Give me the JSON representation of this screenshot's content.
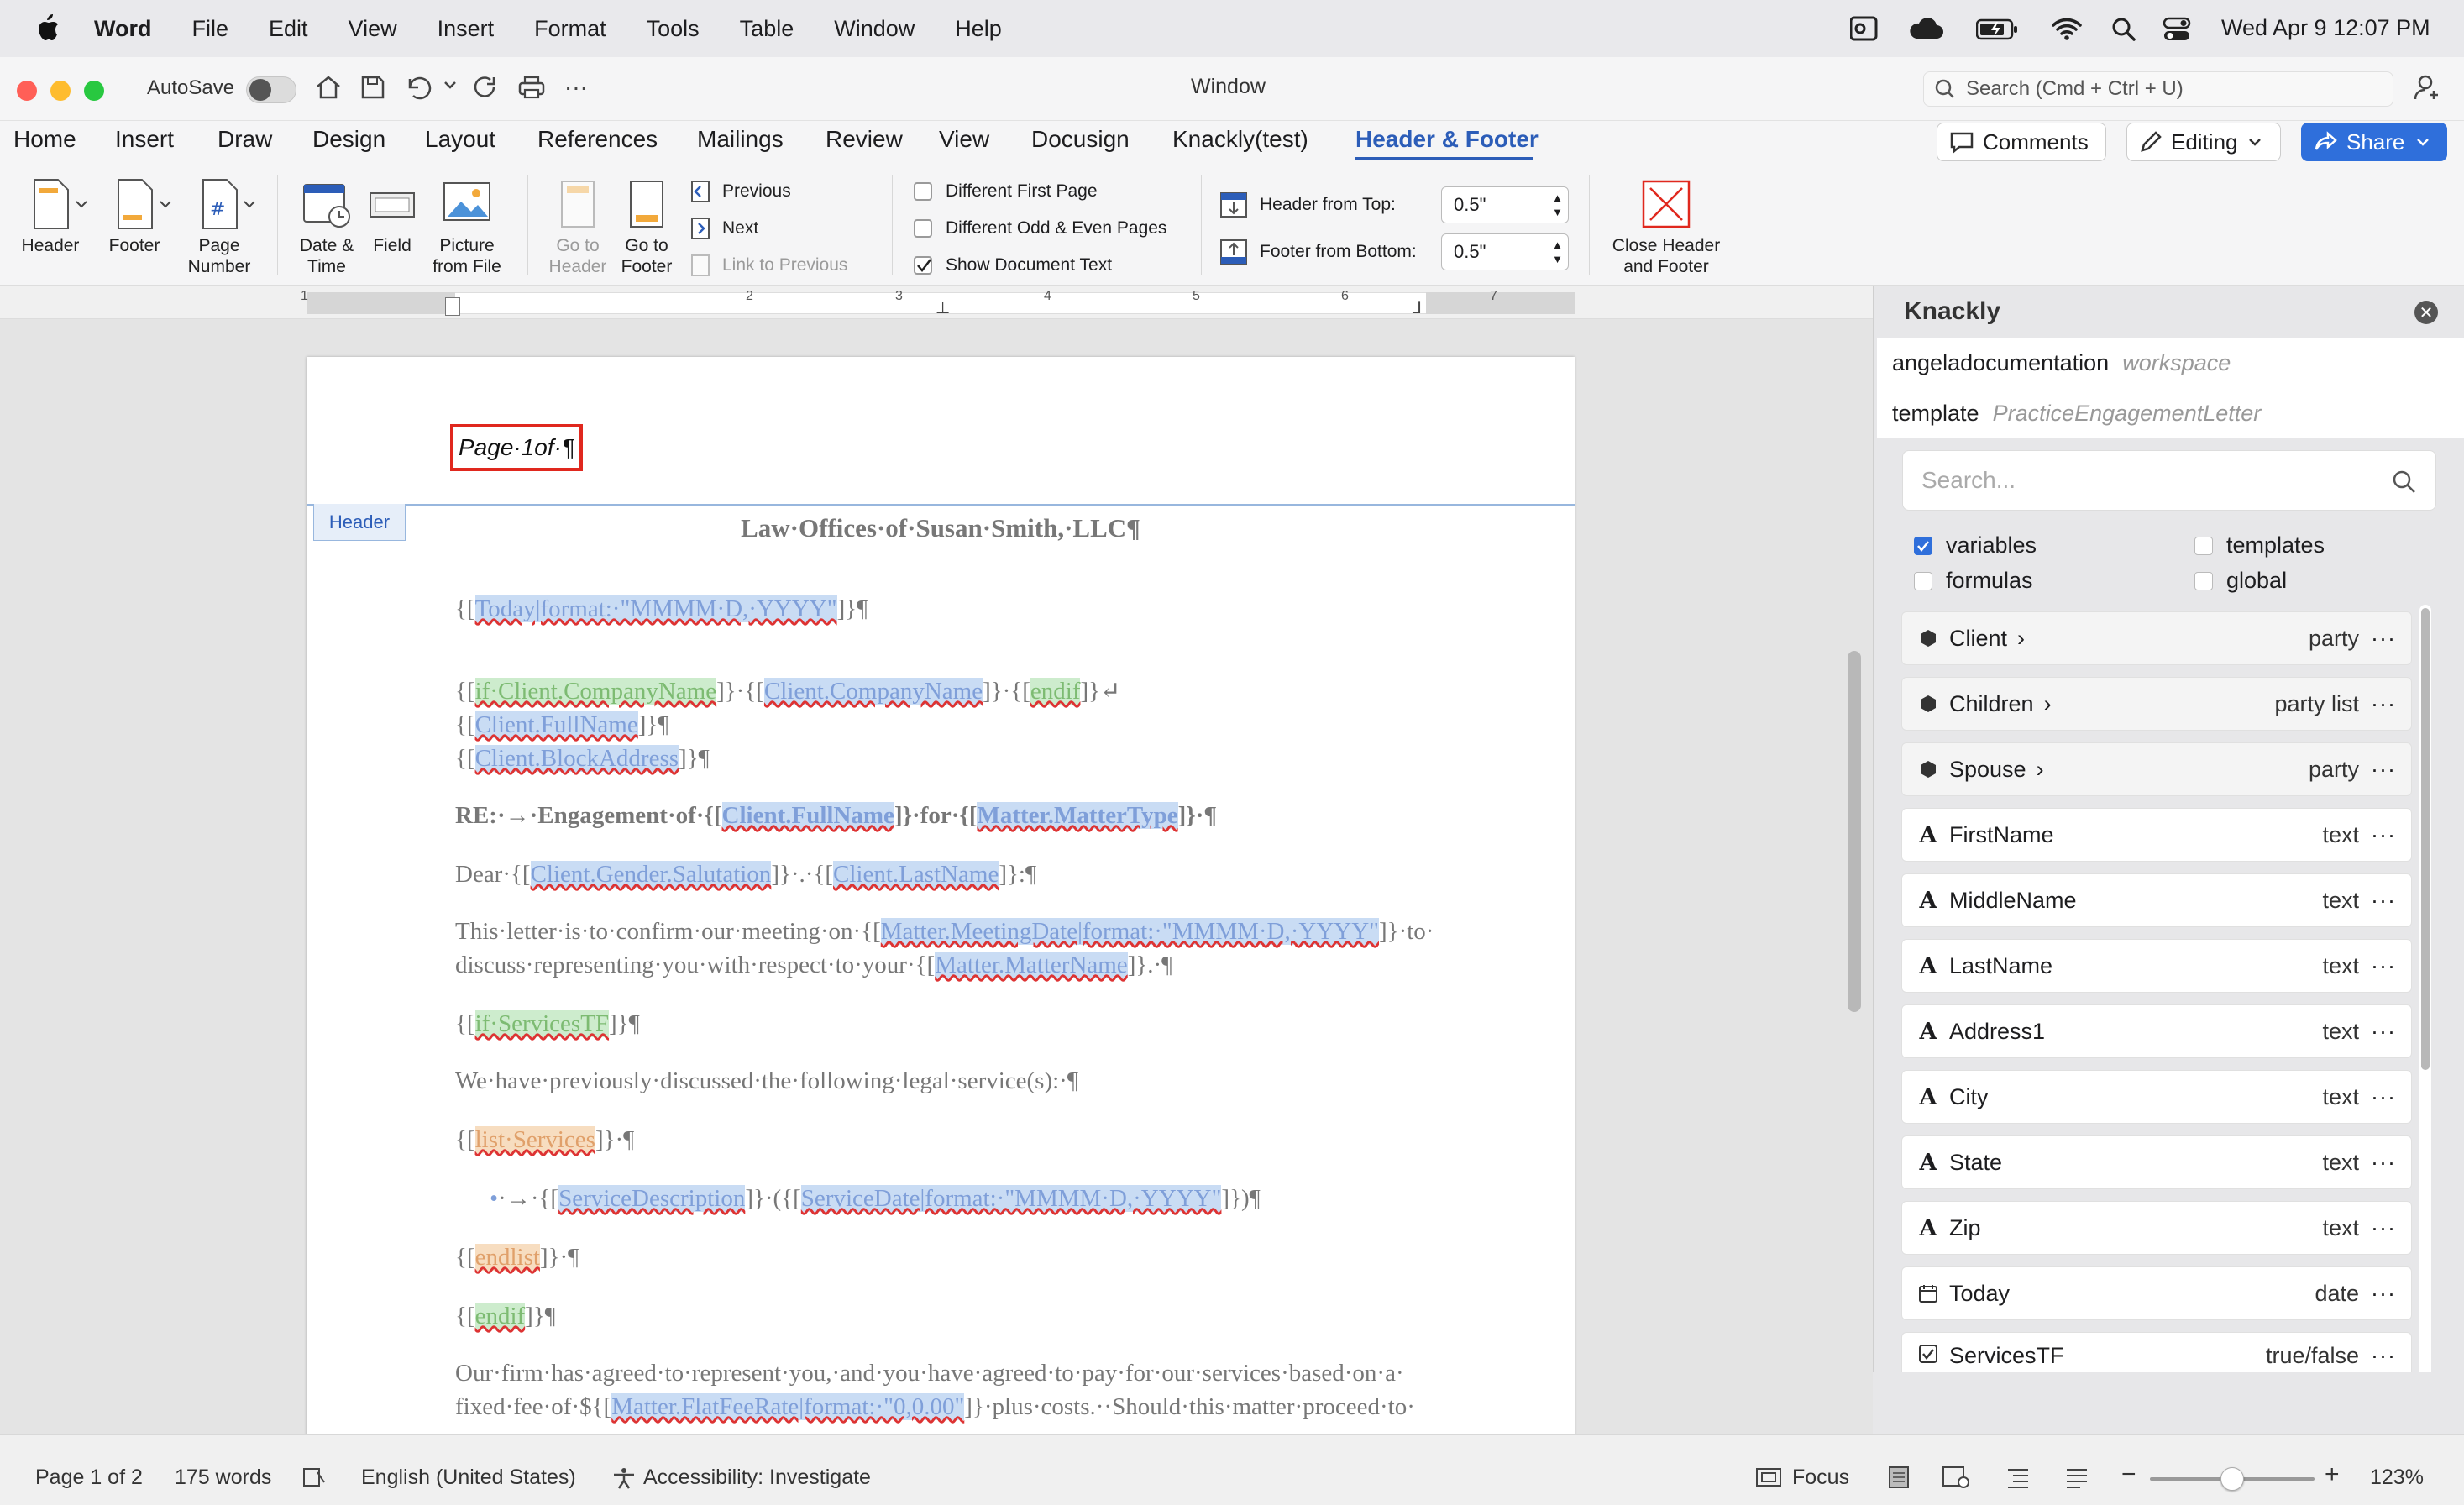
{
  "menubar": {
    "app": "Word",
    "items": [
      "File",
      "Edit",
      "View",
      "Insert",
      "Format",
      "Tools",
      "Table",
      "Window",
      "Help"
    ],
    "datetime": "Wed Apr 9  12:07 PM"
  },
  "titlebar": {
    "autosave_label": "AutoSave",
    "window_title": "Window",
    "search_placeholder": "Search (Cmd + Ctrl + U)"
  },
  "tabs": [
    "Home",
    "Insert",
    "Draw",
    "Design",
    "Layout",
    "References",
    "Mailings",
    "Review",
    "View",
    "Docusign",
    "Knackly(test)",
    "Header & Footer"
  ],
  "active_tab": "Header & Footer",
  "tab_actions": {
    "comments": "Comments",
    "editing": "Editing",
    "share": "Share"
  },
  "ribbon": {
    "header": "Header",
    "footer": "Footer",
    "page_number": [
      "Page",
      "Number"
    ],
    "date_time": [
      "Date &",
      "Time"
    ],
    "field": "Field",
    "picture": [
      "Picture",
      "from File"
    ],
    "go_to_header": [
      "Go to",
      "Header"
    ],
    "go_to_footer": [
      "Go to",
      "Footer"
    ],
    "previous": "Previous",
    "next": "Next",
    "link_to_previous": "Link to Previous",
    "different_first_page": "Different First Page",
    "different_odd_even": "Different Odd & Even Pages",
    "show_document_text": "Show Document Text",
    "header_from_top_label": "Header from Top:",
    "header_from_top_value": "0.5\"",
    "footer_from_bottom_label": "Footer from Bottom:",
    "footer_from_bottom_value": "0.5\"",
    "close": [
      "Close Header",
      "and Footer"
    ]
  },
  "ruler_numbers": [
    "1",
    "2",
    "3",
    "4",
    "5",
    "6",
    "7"
  ],
  "document": {
    "header_text": "Page·1of·¶",
    "header_tag": "Header",
    "title": "Law·Offices·of·Susan·Smith,·LLC¶"
  },
  "panel": {
    "title": "Knackly",
    "workspace_name": "angeladocumentation",
    "workspace_label": "workspace",
    "template_label": "template",
    "template_name": "PracticeEngagementLetter",
    "search_placeholder": "Search...",
    "filters": {
      "variables": "variables",
      "templates": "templates",
      "formulas": "formulas",
      "global": "global"
    },
    "variables": [
      {
        "name": "Client",
        "type": "party",
        "icon": "cube-icon"
      },
      {
        "name": "Children",
        "type": "party list",
        "icon": "cube-icon"
      },
      {
        "name": "Spouse",
        "type": "party",
        "icon": "cube-icon"
      },
      {
        "name": "FirstName",
        "type": "text",
        "icon": "text-type-icon"
      },
      {
        "name": "MiddleName",
        "type": "text",
        "icon": "text-type-icon"
      },
      {
        "name": "LastName",
        "type": "text",
        "icon": "text-type-icon"
      },
      {
        "name": "Address1",
        "type": "text",
        "icon": "text-type-icon"
      },
      {
        "name": "City",
        "type": "text",
        "icon": "text-type-icon"
      },
      {
        "name": "State",
        "type": "text",
        "icon": "text-type-icon"
      },
      {
        "name": "Zip",
        "type": "text",
        "icon": "text-type-icon"
      },
      {
        "name": "Today",
        "type": "date",
        "icon": "calendar-icon"
      },
      {
        "name": "ServicesTF",
        "type": "true/false",
        "icon": "checkbox-icon"
      }
    ]
  },
  "status": {
    "page": "Page 1 of 2",
    "words": "175 words",
    "language": "English (United States)",
    "accessibility": "Accessibility: Investigate",
    "focus": "Focus",
    "zoom": "123%"
  },
  "colors": {
    "accent": "#2c5db8",
    "share": "#2f6fdb",
    "variable_bg": "#c9dcf4",
    "condition_bg": "#cdeccd",
    "list_bg": "#f7ddc0",
    "header_outline": "#e0281e"
  }
}
